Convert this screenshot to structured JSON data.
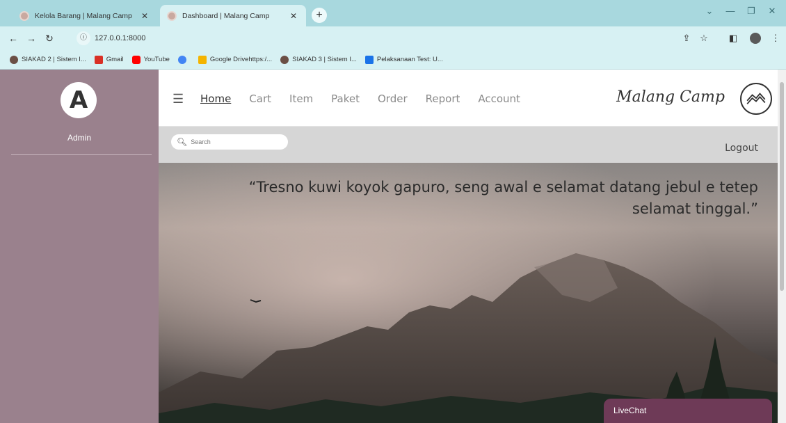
{
  "browser": {
    "tabs": [
      {
        "title": "Kelola Barang | Malang Camp",
        "active": false
      },
      {
        "title": "Dashboard | Malang Camp",
        "active": true
      }
    ],
    "close_glyph": "✕",
    "new_tab_glyph": "+",
    "address": "127.0.0.1:8000",
    "bookmarks": [
      {
        "label": "SIAKAD 2 | Sistem I...",
        "icon": "siakad-icon",
        "color": "#6b4f45"
      },
      {
        "label": "Gmail",
        "icon": "gmail-icon",
        "color": "#d93025"
      },
      {
        "label": "YouTube",
        "icon": "youtube-icon",
        "color": "#ff0000"
      },
      {
        "label": "",
        "icon": "google-icon",
        "color": "#4285f4"
      },
      {
        "label": "Google Drivehttps:/...",
        "icon": "drive-icon",
        "color": "#f4b400"
      },
      {
        "label": "SIAKAD 3 | Sistem I...",
        "icon": "siakad-icon",
        "color": "#6b4f45"
      },
      {
        "label": "Pelaksanaan Test: U...",
        "icon": "test-icon",
        "color": "#1a73e8"
      }
    ]
  },
  "sidebar": {
    "avatar_letter": "A",
    "user_name": "Admin",
    "bg_color": "#9a818d"
  },
  "nav": {
    "links": [
      "Home",
      "Cart",
      "Item",
      "Paket",
      "Order",
      "Report",
      "Account"
    ],
    "active": "Home",
    "brand": "Malang Camp"
  },
  "search": {
    "placeholder": "Search"
  },
  "logout_label": "Logout",
  "hero": {
    "quote": "“Tresno kuwi koyok gapuro, seng awal e selamat datang jebul e tetep selamat tinggal.”"
  },
  "livechat": {
    "label": "LiveChat",
    "color": "#6e3a57"
  }
}
